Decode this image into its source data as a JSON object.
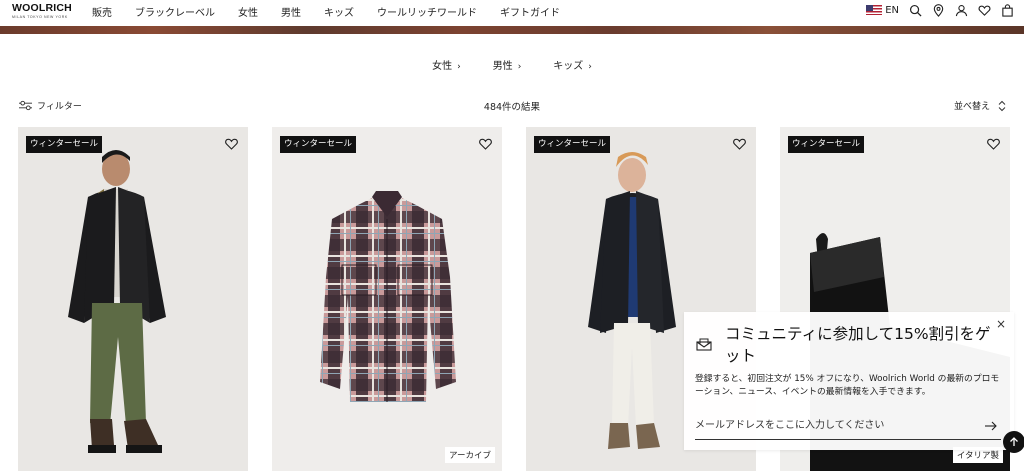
{
  "header": {
    "logo": {
      "main": "WOOLRICH",
      "sub": "MILAN TOKYO NEW YORK"
    },
    "nav": [
      {
        "label": "販売"
      },
      {
        "label": "ブラックレーベル"
      },
      {
        "label": "女性"
      },
      {
        "label": "男性"
      },
      {
        "label": "キッズ"
      },
      {
        "label": "ウールリッチワールド"
      },
      {
        "label": "ギフトガイド"
      }
    ],
    "language": "EN",
    "icons": [
      "us-flag-icon",
      "search-icon",
      "location-pin-icon",
      "user-icon",
      "heart-icon",
      "shopping-bag-icon"
    ]
  },
  "categories": [
    {
      "label": "女性",
      "chevron": "›"
    },
    {
      "label": "男性",
      "chevron": "›"
    },
    {
      "label": "キッズ",
      "chevron": "›"
    }
  ],
  "toolbar": {
    "filter_label": "フィルター",
    "results_text": "484件の結果",
    "sort_label": "並べ替え"
  },
  "products": [
    {
      "badge": "ウィンターセール",
      "bottom_tag": ""
    },
    {
      "badge": "ウィンターセール",
      "bottom_tag": "アーカイブ"
    },
    {
      "badge": "ウィンターセール",
      "bottom_tag": ""
    },
    {
      "badge": "ウィンターセール",
      "bottom_tag": "イタリア製"
    }
  ],
  "popup": {
    "close": "×",
    "title": "コミュニティに参加して15%割引をゲット",
    "text": "登録すると、初回注文が 15% オフになり、Woolrich World の最新のプロモーション、ニュース、イベントの最新情報を入手できます。",
    "email_placeholder": "メールアドレスをここに入力してください"
  }
}
